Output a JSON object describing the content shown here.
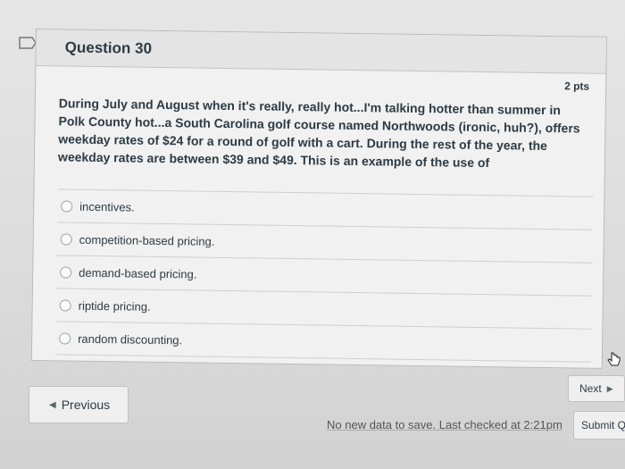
{
  "question": {
    "title": "Question 30",
    "points": "2 pts",
    "body": "During July and August when it's really, really hot...I'm talking hotter than summer in Polk County hot...a South Carolina golf course named Northwoods (ironic, huh?), offers weekday rates of $24 for a round of golf with a cart. During the rest of the year, the weekday rates are between $39 and $49. This is an example of the use of",
    "answers": [
      {
        "label": "incentives."
      },
      {
        "label": "competition-based pricing."
      },
      {
        "label": "demand-based pricing."
      },
      {
        "label": "riptide pricing."
      },
      {
        "label": "random discounting."
      }
    ]
  },
  "nav": {
    "previous_label": "Previous",
    "next_label": "Next",
    "submit_label": "Submit Q"
  },
  "status": "No new data to save. Last checked at 2:21pm"
}
